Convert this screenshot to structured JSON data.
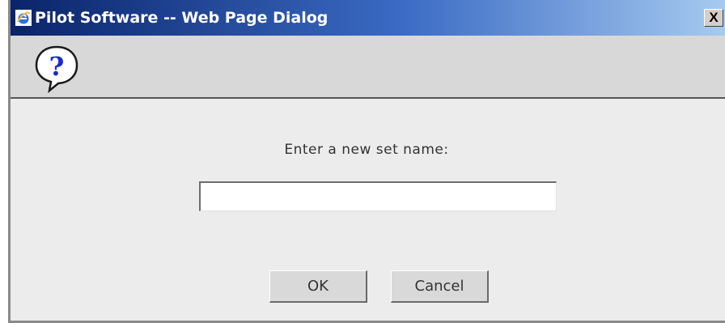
{
  "window": {
    "title": "Pilot Software -- Web Page Dialog",
    "close_label": "X"
  },
  "header": {
    "icon": "help-question-icon",
    "icon_glyph": "?"
  },
  "form": {
    "prompt": "Enter a new set name:",
    "set_name_value": "",
    "set_name_placeholder": ""
  },
  "buttons": {
    "ok_label": "OK",
    "cancel_label": "Cancel"
  },
  "colors": {
    "title_start": "#0a246a",
    "title_end": "#a6caf0",
    "dialog_bg": "#ececec",
    "header_bg": "#d8d8d8",
    "help_blue": "#1d2bcf"
  }
}
